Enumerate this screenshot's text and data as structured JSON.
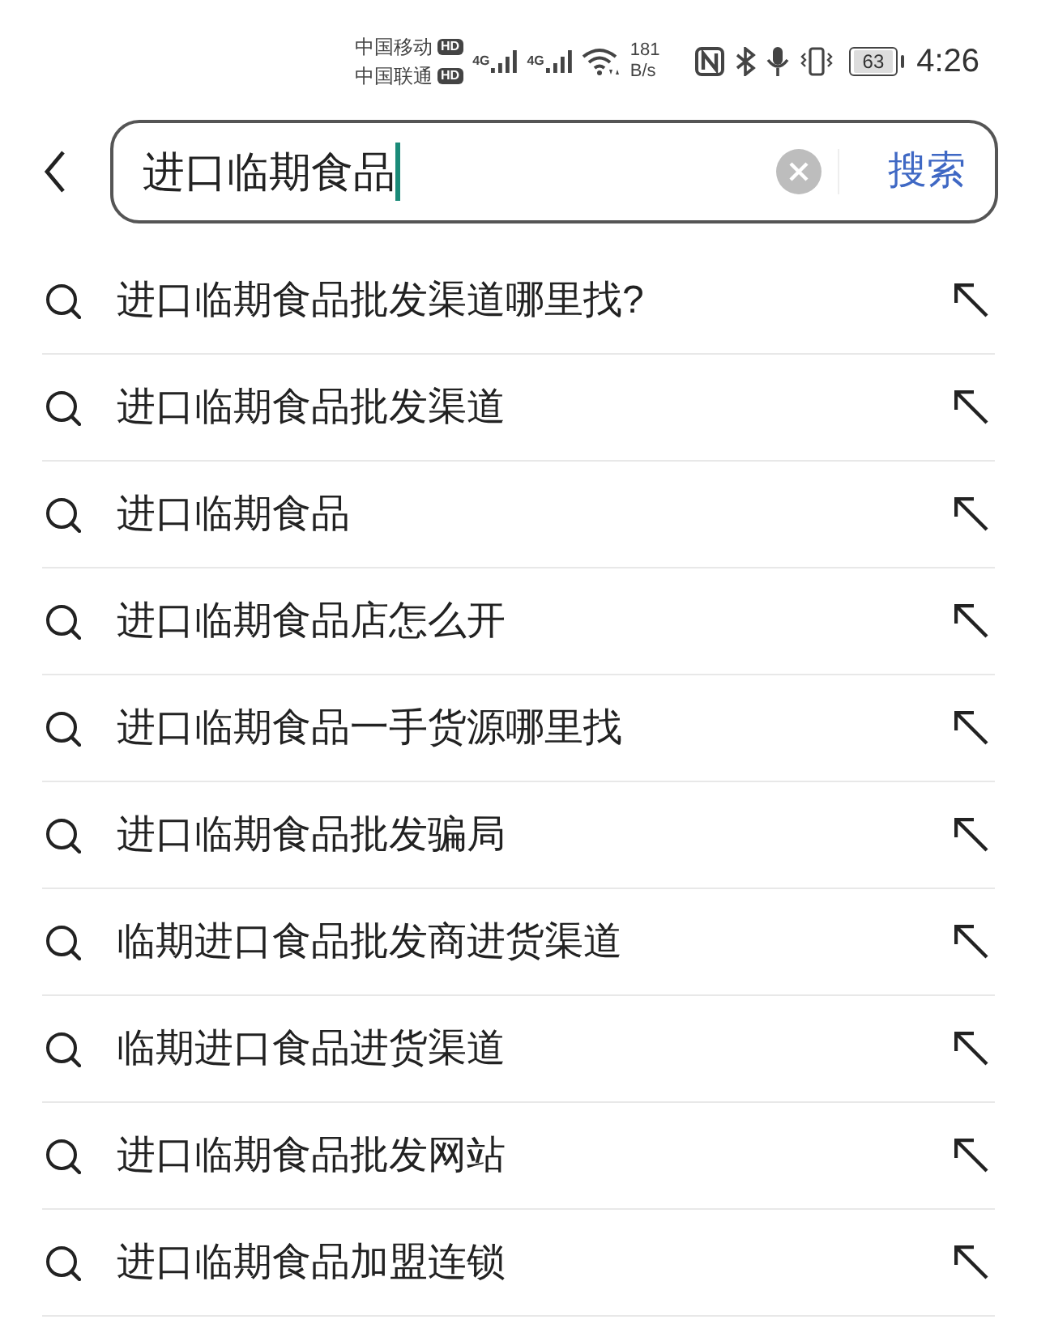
{
  "status_bar": {
    "carriers": [
      {
        "name": "中国移动",
        "badge": "HD"
      },
      {
        "name": "中国联通",
        "badge": "HD"
      }
    ],
    "signals": [
      {
        "label": "4G"
      },
      {
        "label": "4G"
      }
    ],
    "speed": {
      "value": "181",
      "unit": "B/s"
    },
    "battery": "63",
    "time": "4:26"
  },
  "search": {
    "value": "进口临期食品",
    "focused": true,
    "button": "搜索"
  },
  "suggestions": [
    {
      "text": "进口临期食品批发渠道哪里找?"
    },
    {
      "text": "进口临期食品批发渠道"
    },
    {
      "text": "进口临期食品"
    },
    {
      "text": "进口临期食品店怎么开"
    },
    {
      "text": "进口临期食品一手货源哪里找"
    },
    {
      "text": "进口临期食品批发骗局"
    },
    {
      "text": "临期进口食品批发商进货渠道"
    },
    {
      "text": "临期进口食品进货渠道"
    },
    {
      "text": "进口临期食品批发网站"
    },
    {
      "text": "进口临期食品加盟连锁"
    }
  ]
}
